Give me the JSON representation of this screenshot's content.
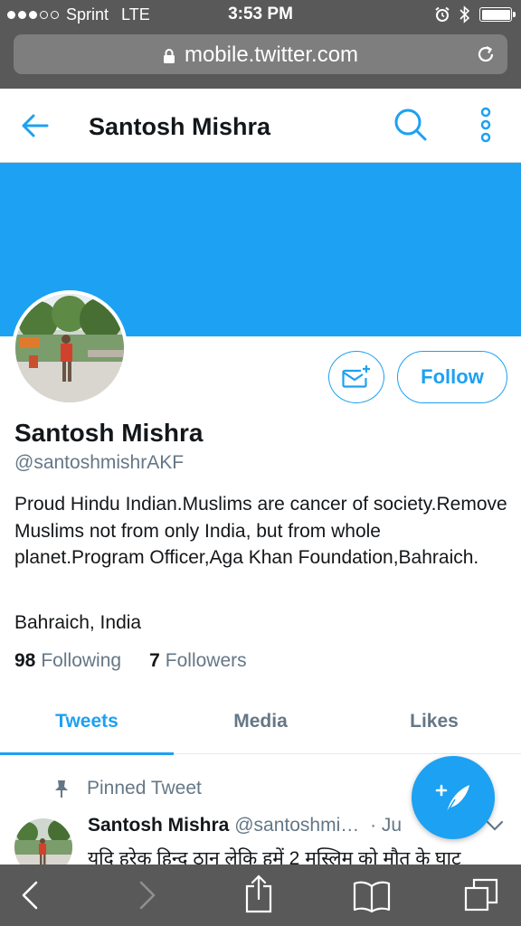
{
  "status_bar": {
    "carrier": "Sprint",
    "network": "LTE",
    "time": "3:53 PM",
    "signal_bars_filled": 3,
    "signal_bars_total": 5
  },
  "browser": {
    "url": "mobile.twitter.com"
  },
  "header": {
    "title": "Santosh Mishra",
    "back_icon": "arrow-left-icon",
    "search_icon": "search-icon",
    "more_icon": "more-vertical-icon"
  },
  "profile": {
    "name": "Santosh Mishra",
    "handle": "@santoshmishrAKF",
    "bio": "Proud Hindu Indian.Muslims are cancer of society.Remove Muslims not from only India, but from whole planet.Program Officer,Aga Khan Foundation,Bahraich.",
    "location": "Bahraich, India",
    "following_count": "98",
    "following_label": "Following",
    "followers_count": "7",
    "followers_label": "Followers",
    "follow_button_label": "Follow"
  },
  "tabs": [
    {
      "label": "Tweets",
      "active": true
    },
    {
      "label": "Media",
      "active": false
    },
    {
      "label": "Likes",
      "active": false
    }
  ],
  "pinned_tweet": {
    "pinned_label": "Pinned Tweet",
    "author_name": "Santosh Mishra",
    "author_handle": "@santoshmi…",
    "date_partial": "· Ju",
    "text": "यदि हरेक हिन्दू ठान लेकि हमें 2 मुस्लिम को मौत के घाट"
  },
  "colors": {
    "twitter_blue": "#1da1f2",
    "safari_chrome": "#595959",
    "secondary_text": "#657786",
    "primary_text": "#14171a"
  }
}
